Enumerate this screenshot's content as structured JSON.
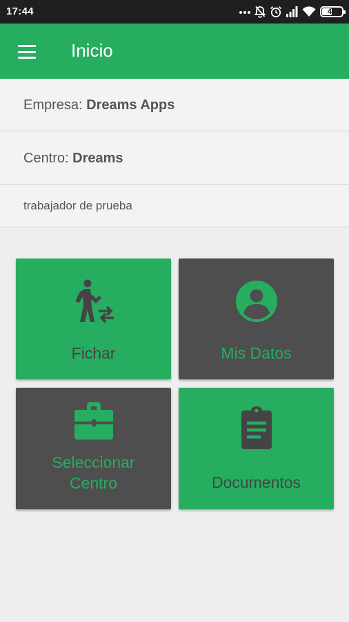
{
  "status_bar": {
    "time": "17:44",
    "battery_level": "48",
    "icons": [
      "more-dots-icon",
      "notifications-muted-icon",
      "alarm-icon",
      "signal-icon",
      "wifi-icon",
      "battery-icon"
    ]
  },
  "app_bar": {
    "menu_icon": "hamburger-menu-icon",
    "title": "Inicio",
    "color": "#26ad5f"
  },
  "info": {
    "empresa_label": "Empresa:",
    "empresa_value": "Dreams Apps",
    "centro_label": "Centro:",
    "centro_value": "Dreams",
    "worker_name": "trabajador de prueba"
  },
  "tiles": [
    {
      "label": "Fichar",
      "icon": "walking-person-swap-icon",
      "background": "#27ad60"
    },
    {
      "label": "Mis Datos",
      "icon": "account-circle-icon",
      "background": "#4e4e4e"
    },
    {
      "label_line1": "Seleccionar",
      "label_line2": "Centro",
      "icon": "briefcase-icon",
      "background": "#4e4e4e"
    },
    {
      "label": "Documentos",
      "icon": "clipboard-text-icon",
      "background": "#27ad60"
    }
  ]
}
